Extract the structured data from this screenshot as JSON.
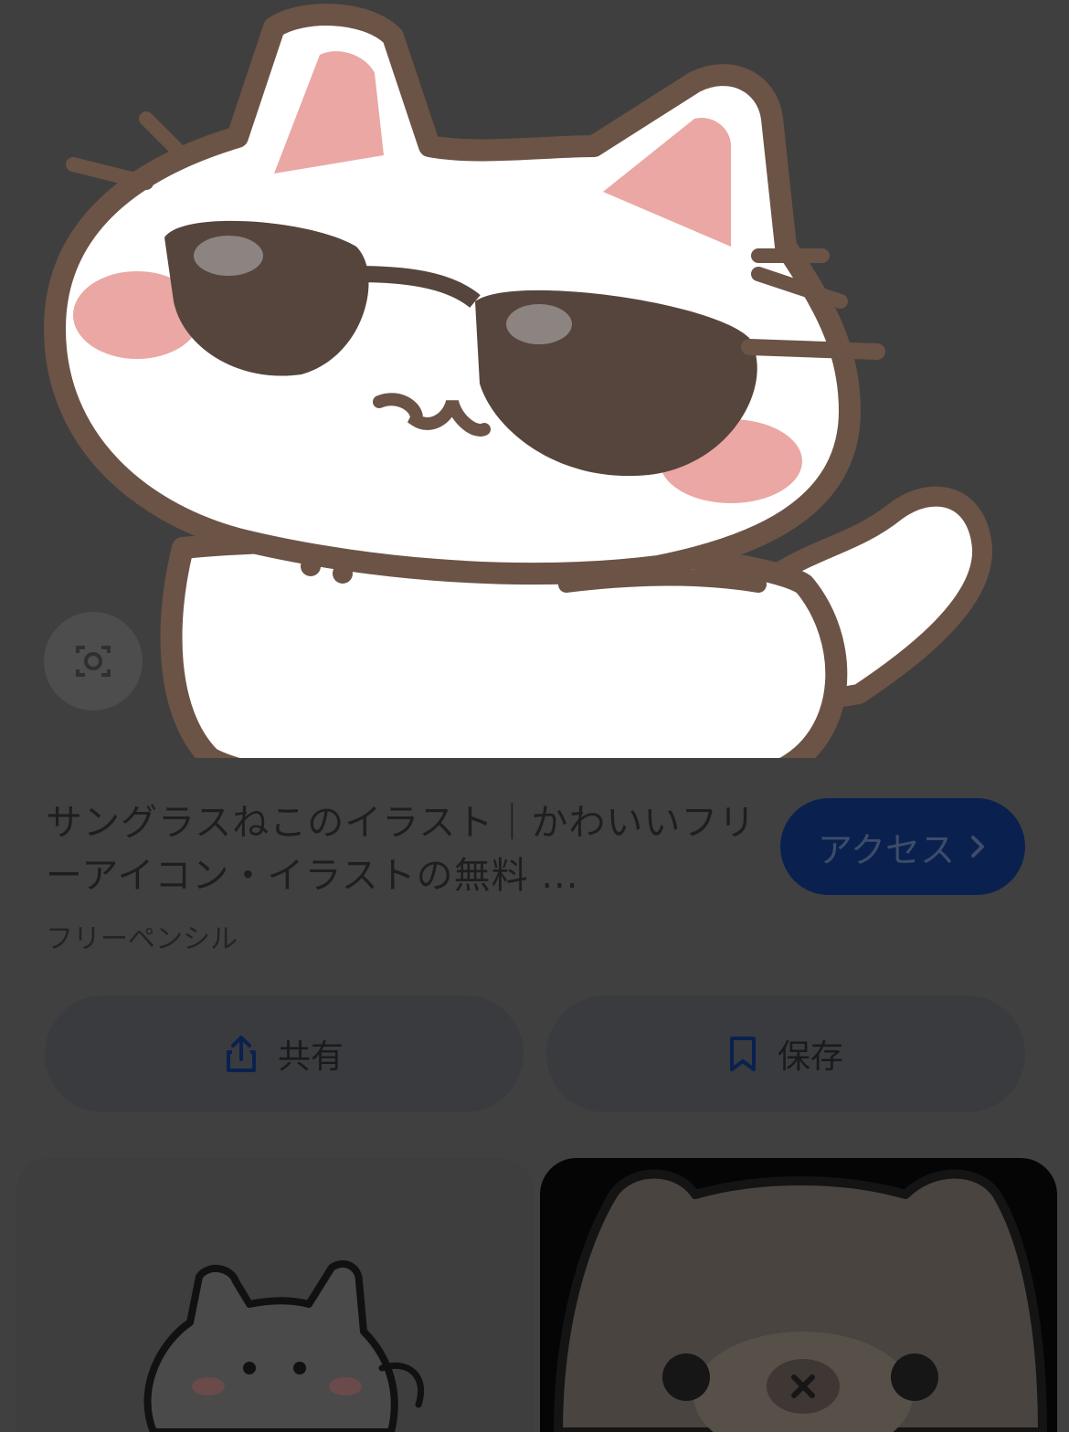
{
  "result": {
    "title": "サングラスねこのイラスト｜かわいいフリーアイコン・イラストの無料 ...",
    "source": "フリーペンシル",
    "visit_label": "アクセス"
  },
  "actions": {
    "share_label": "共有",
    "save_label": "保存"
  },
  "icons": {
    "lens": "camera-search-icon",
    "chevron": "chevron-right-icon",
    "share": "share-icon",
    "save": "bookmark-icon"
  },
  "colors": {
    "background": "#404040",
    "visit_button": "#0a2150",
    "action_button": "#393b3f"
  }
}
